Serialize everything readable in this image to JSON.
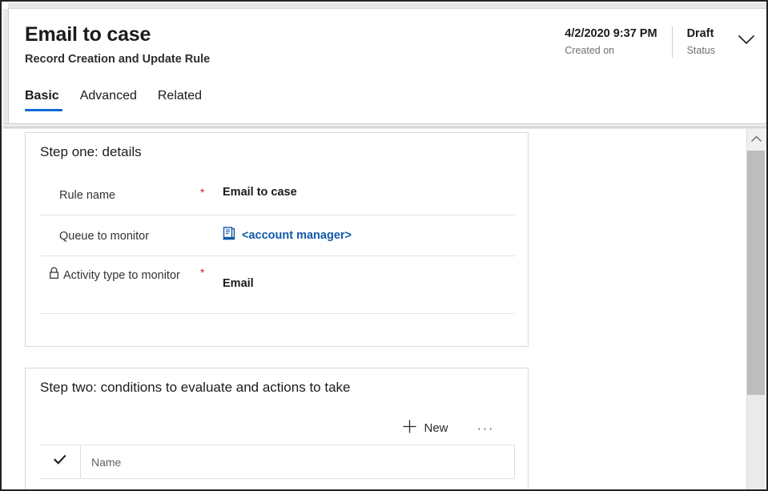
{
  "header": {
    "title": "Email to case",
    "subtitle": "Record Creation and Update Rule",
    "created_on_value": "4/2/2020 9:37 PM",
    "created_on_label": "Created on",
    "status_value": "Draft",
    "status_label": "Status",
    "chevron_icon": "chevron-down-icon"
  },
  "tabs": [
    {
      "label": "Basic",
      "selected": true
    },
    {
      "label": "Advanced",
      "selected": false
    },
    {
      "label": "Related",
      "selected": false
    }
  ],
  "step_one": {
    "title": "Step one: details",
    "fields": [
      {
        "label": "Rule name",
        "required": "*",
        "value": "Email to case",
        "locked": false,
        "is_link": false
      },
      {
        "label": "Queue to monitor",
        "required": "",
        "value": "<account manager>",
        "locked": false,
        "is_link": true,
        "icon": "queue-icon"
      },
      {
        "label": "Activity type to monitor",
        "required": "*",
        "value": "Email",
        "locked": true,
        "is_link": false,
        "icon": "lock-icon"
      }
    ]
  },
  "step_two": {
    "title": "Step two: conditions to evaluate and actions to take",
    "commands": {
      "new_label": "New",
      "new_icon": "plus-icon",
      "overflow_label": "···",
      "overflow_icon": "ellipsis-icon"
    },
    "grid": {
      "select_all_icon": "checkmark-icon",
      "columns": [
        "Name"
      ],
      "rows": []
    }
  },
  "scrollbar": {
    "up_icon": "chevron-up-icon"
  },
  "colors": {
    "accent_blue": "#1268d4",
    "link_blue": "#1359a8",
    "required_red": "#c0261e",
    "muted_text": "#707070",
    "border": "#d9d9d9"
  }
}
